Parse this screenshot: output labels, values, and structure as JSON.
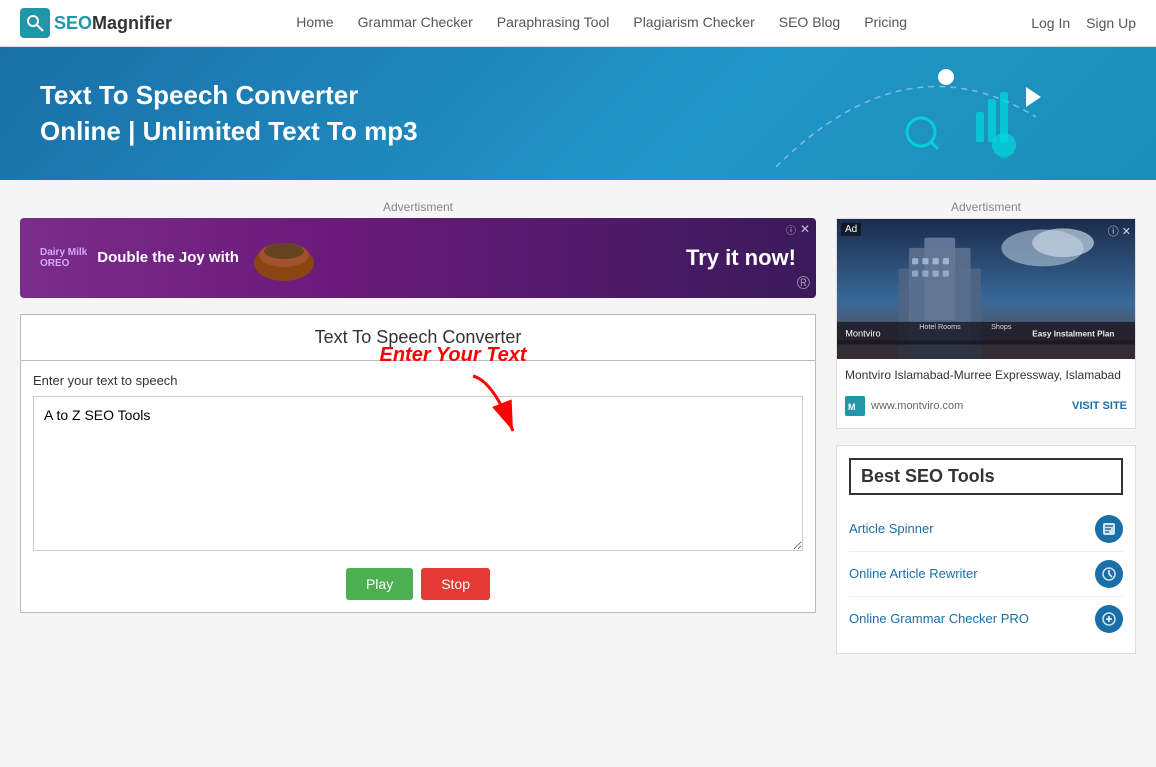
{
  "nav": {
    "logo_seo": "SEO",
    "logo_magnifier": "Magnifier",
    "links": [
      {
        "label": "Home",
        "href": "#"
      },
      {
        "label": "Grammar Checker",
        "href": "#"
      },
      {
        "label": "Paraphrasing Tool",
        "href": "#"
      },
      {
        "label": "Plagiarism Checker",
        "href": "#"
      },
      {
        "label": "SEO Blog",
        "href": "#"
      },
      {
        "label": "Pricing",
        "href": "#"
      }
    ],
    "auth": [
      {
        "label": "Log In",
        "href": "#"
      },
      {
        "label": "Sign Up",
        "href": "#"
      }
    ]
  },
  "hero": {
    "title": "Text To Speech Converter Online | Unlimited Text To mp3"
  },
  "ad": {
    "label": "Advertisment",
    "brand": "Dairy Milk OREO",
    "slogan": "Double the Joy with",
    "cta": "Try it now!"
  },
  "tool": {
    "title": "Text To Speech Converter",
    "input_label": "Enter your text to speech",
    "textarea_placeholder": "A to Z SEO Tools",
    "textarea_value": "A to Z SEO Tools",
    "annotation_text": "Enter Your Text",
    "btn_play": "Play",
    "btn_stop": "Stop"
  },
  "sidebar": {
    "ad_label": "Advertisment",
    "ad_desc": "Montviro Islamabad-Murree Expressway, Islamabad",
    "ad_site_text": "www.montviro.com",
    "ad_visit": "VISIT SITE",
    "ad_bottom_hotel": "Hotel Rooms",
    "ad_bottom_shops": "Shops",
    "ad_bottom_brand": "Montviro",
    "ad_bottom_tagline": "Easy Instalment Plan",
    "best_seo_title": "Best SEO Tools",
    "tools": [
      {
        "label": "Article Spinner",
        "icon": "📝"
      },
      {
        "label": "Online Article Rewriter",
        "icon": "✏️"
      },
      {
        "label": "Online Grammar Checker PRO",
        "icon": "📖"
      }
    ]
  }
}
